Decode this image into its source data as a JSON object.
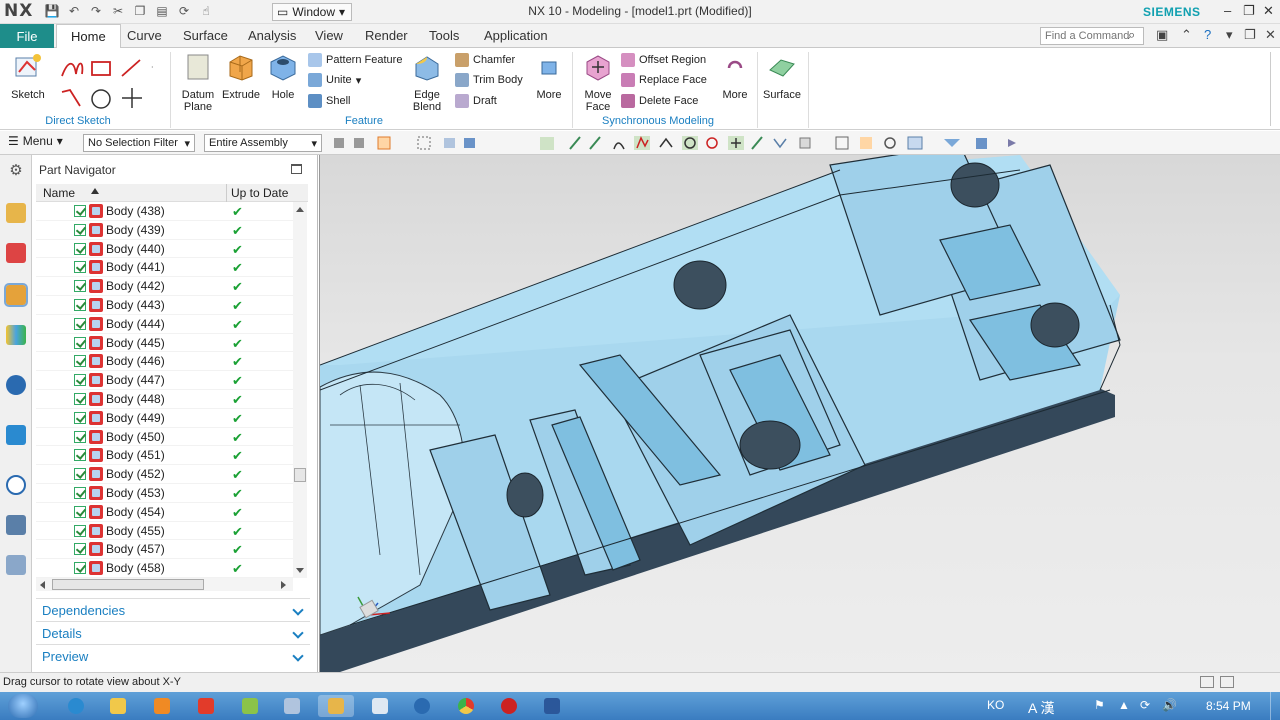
{
  "app": {
    "logo": "NX",
    "window_menu": "Window",
    "title": "NX 10 - Modeling - [model1.prt (Modified)]",
    "brand": "SIEMENS"
  },
  "tabs": {
    "file": "File",
    "items": [
      "Home",
      "Curve",
      "Surface",
      "Analysis",
      "View",
      "Render",
      "Tools",
      "Application"
    ],
    "active": "Home",
    "search_placeholder": "Find a Command"
  },
  "ribbon": {
    "sketch": "Sketch",
    "direct_sketch_label": "Direct Sketch",
    "datum_plane": [
      "Datum",
      "Plane"
    ],
    "extrude": "Extrude",
    "hole": "Hole",
    "pattern_feature": "Pattern Feature",
    "unite": "Unite",
    "shell": "Shell",
    "edge_blend": [
      "Edge",
      "Blend"
    ],
    "chamfer": "Chamfer",
    "trim_body": "Trim Body",
    "draft": "Draft",
    "more": "More",
    "feature_label": "Feature",
    "move_face": [
      "Move",
      "Face"
    ],
    "offset_region": "Offset Region",
    "replace_face": "Replace Face",
    "delete_face": "Delete Face",
    "more2": "More",
    "sync_label": "Synchronous Modeling",
    "surface": "Surface"
  },
  "cmdbar": {
    "menu": "Menu",
    "selection_filter": "No Selection Filter",
    "scope": "Entire Assembly"
  },
  "navigator": {
    "title": "Part Navigator",
    "col_name": "Name",
    "col_uptodate": "Up to Date",
    "rows": [
      "Body (438)",
      "Body (439)",
      "Body (440)",
      "Body (441)",
      "Body (442)",
      "Body (443)",
      "Body (444)",
      "Body (445)",
      "Body (446)",
      "Body (447)",
      "Body (448)",
      "Body (449)",
      "Body (450)",
      "Body (451)",
      "Body (452)",
      "Body (453)",
      "Body (454)",
      "Body (455)",
      "Body (457)",
      "Body (458)"
    ],
    "panels": [
      "Dependencies",
      "Details",
      "Preview"
    ]
  },
  "status": {
    "message": "Drag cursor to rotate view about X-Y"
  },
  "taskbar": {
    "lang": "KO",
    "ime": "A 漢",
    "time": "8:54 PM"
  },
  "colors": {
    "file_tab": "#1e8d8a",
    "group_label": "#1a7fc1",
    "check_green": "#1aa134",
    "model_face": "#a9d8ef"
  }
}
